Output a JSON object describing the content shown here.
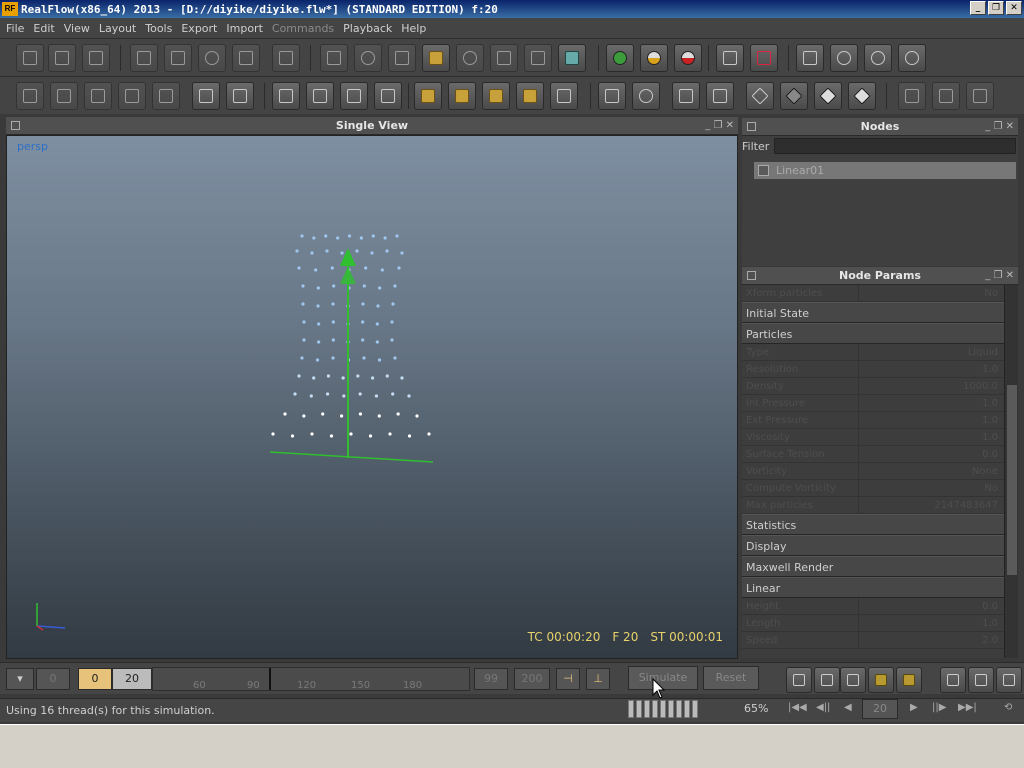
{
  "window": {
    "title": "RealFlow(x86_64) 2013 - [D://diyike/diyike.flw*] (STANDARD EDITION) f:20",
    "logo": "RF",
    "controls": [
      "_",
      "❐",
      "✕"
    ]
  },
  "menu": [
    "File",
    "Edit",
    "View",
    "Layout",
    "Tools",
    "Export",
    "Import",
    "Commands",
    "Playback",
    "Help"
  ],
  "viewport": {
    "title": "Single View",
    "camera": "persp",
    "timecode": "TC 00:00:20",
    "frame": "F 20",
    "sim_time": "ST 00:00:01"
  },
  "nodes": {
    "title": "Nodes",
    "filter_label": "Filter",
    "items": [
      {
        "name": "Linear01"
      }
    ]
  },
  "params": {
    "title": "Node Params",
    "top_rows": [
      {
        "label": "Xform particles",
        "value": "No"
      }
    ],
    "sections_a": [
      "Initial State",
      "Particles"
    ],
    "particle_rows": [
      {
        "label": "Type",
        "value": "Liquid"
      },
      {
        "label": "Resolution",
        "value": "1.0"
      },
      {
        "label": "Density",
        "value": "1000.0"
      },
      {
        "label": "Int Pressure",
        "value": "1.0"
      },
      {
        "label": "Ext Pressure",
        "value": "1.0"
      },
      {
        "label": "Viscosity",
        "value": "1.0"
      },
      {
        "label": "Surface Tension",
        "value": "0.0"
      },
      {
        "label": "Vorticity",
        "value": "None"
      },
      {
        "label": "Compute Vorticity",
        "value": "No"
      },
      {
        "label": "Max particles",
        "value": "2147483647"
      }
    ],
    "sections_b": [
      "Statistics",
      "Display",
      "Maxwell Render",
      "Linear"
    ],
    "linear_rows": [
      {
        "label": "Height",
        "value": "0.0"
      },
      {
        "label": "Length",
        "value": "1.0"
      },
      {
        "label": "Speed",
        "value": "2.0"
      }
    ]
  },
  "timeline": {
    "start": "0",
    "current": "0",
    "end": "20",
    "ticks": [
      "60",
      "90",
      "120",
      "150",
      "180"
    ],
    "range_a": "99",
    "range_b": "200",
    "simulate_label": "Simulate",
    "reset_label": "Reset"
  },
  "status": {
    "message": "Using 16 thread(s) for this simulation.",
    "zoom": "65%",
    "frame_field": "20"
  }
}
